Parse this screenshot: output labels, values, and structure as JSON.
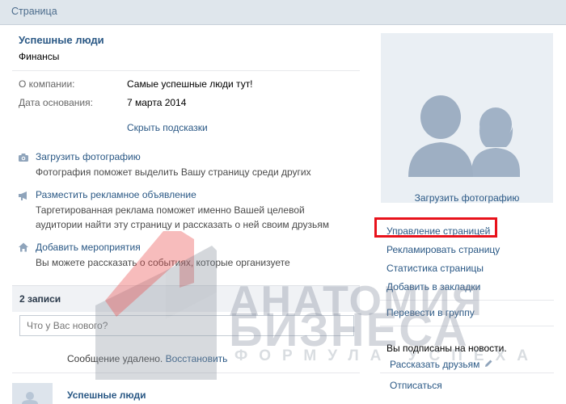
{
  "header": {
    "title": "Страница"
  },
  "page": {
    "name": "Успешные люди",
    "category": "Финансы"
  },
  "info": [
    {
      "label": "О компании:",
      "value": "Самые успешные люди тут!"
    },
    {
      "label": "Дата основания:",
      "value": "7 марта 2014"
    }
  ],
  "hide_tips_label": "Скрыть подсказки",
  "tips": [
    {
      "icon": "camera-icon",
      "title": "Загрузить фотографию",
      "text": "Фотография поможет выделить Вашу страницу среди других"
    },
    {
      "icon": "megaphone-icon",
      "title": "Разместить рекламное объявление",
      "text": "Таргетированная реклама поможет именно Вашей целевой аудитории найти эту страницу и рассказать о ней своим друзьям"
    },
    {
      "icon": "home-icon",
      "title": "Добавить мероприятия",
      "text": "Вы можете рассказать о событиях, которые организуете"
    }
  ],
  "posts": {
    "count_label": "2 записи",
    "input_placeholder": "Что у Вас нового?",
    "deleted_text": "Сообщение удалено.",
    "restore_label": "Восстановить",
    "author": "Успешные люди"
  },
  "sidebar": {
    "upload_photo_label": "Загрузить фотографию",
    "links": [
      "Управление страницей",
      "Рекламировать страницу",
      "Статистика страницы",
      "Добавить в закладки"
    ],
    "transfer_label": "Перевести в группу",
    "subscribed_text": "Вы подписаны на новости.",
    "tell_friends_label": "Рассказать друзьям",
    "unsubscribe_label": "Отписаться"
  },
  "watermark": {
    "line1": "АНАТОМИЯ",
    "line2": "БИЗНЕСА",
    "line3": "ФОРМУЛА УСПЕХА"
  },
  "colors": {
    "link": "#2a5885",
    "highlight_border": "#e8121b",
    "header_bg": "#dfe6ec",
    "page_bg": "#ffffff"
  }
}
